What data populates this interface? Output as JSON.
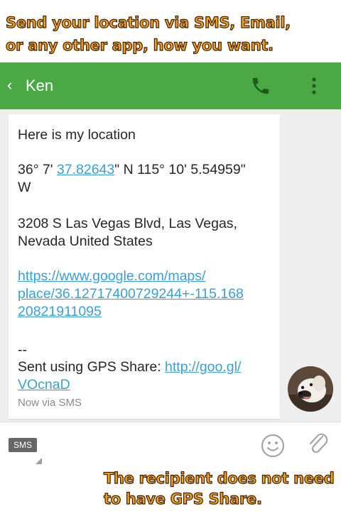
{
  "promo": {
    "top_line1": "Send your location via SMS, Email,",
    "top_line2": "or any other app, how you want.",
    "bottom_line1": "The recipient does not need",
    "bottom_line2": "to have GPS Share."
  },
  "appbar": {
    "back_glyph": "‹",
    "contact_name": "Ken",
    "icons": [
      "back-icon",
      "phone-icon",
      "more-vert-icon"
    ],
    "color": "#4aa945"
  },
  "message": {
    "line1": "Here is my location",
    "coords_prefix": "36° 7' ",
    "coords_link": "37.82643",
    "coords_rest1": "\" N  115° 10' 5.54959\"",
    "coords_rest2": "W",
    "address1": "3208 S Las Vegas Blvd, Las Vegas,",
    "address2": "Nevada United States",
    "maps_url1": "https://www.google.com/maps/",
    "maps_url2": "place/36.12717400729244+-115.168",
    "maps_url3": "20821911095",
    "separator": "--",
    "sent_prefix": "Sent using GPS Share: ",
    "short_url1": "http://goo.gl/",
    "short_url2": "VOcnaD",
    "meta": "Now via SMS"
  },
  "composer": {
    "mode_label": "SMS",
    "icons": [
      "emoji-icon",
      "attach-icon"
    ]
  },
  "colors": {
    "link": "#3a9fd6",
    "thread_bg": "#eeeeee",
    "promo_fill": "#f7a01a"
  }
}
